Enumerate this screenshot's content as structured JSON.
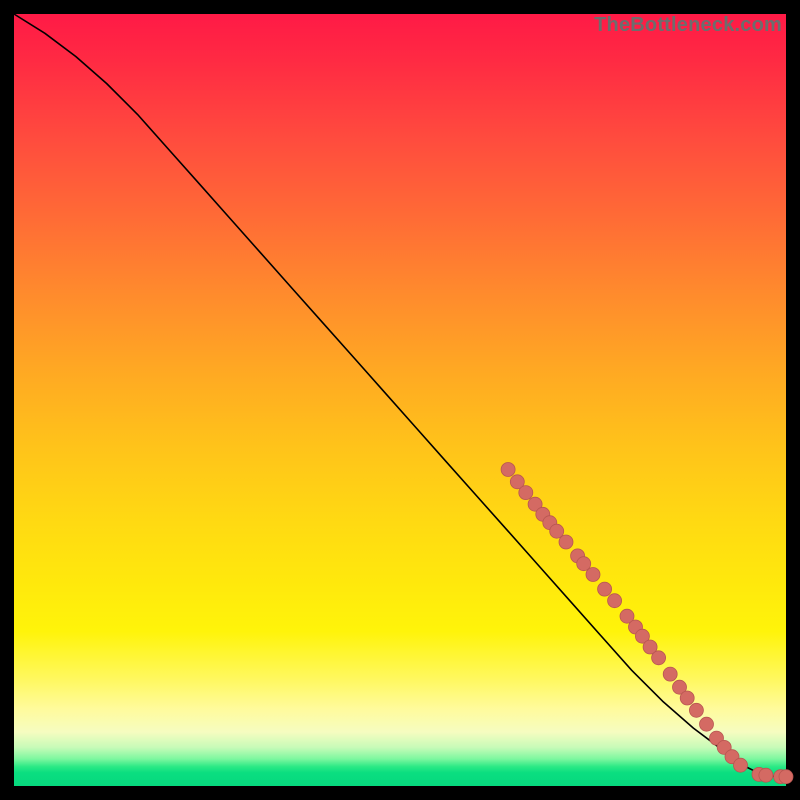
{
  "watermark": "TheBottleneck.com",
  "colors": {
    "dot_fill": "#d46a63",
    "dot_stroke": "#b85651",
    "line": "#000000"
  },
  "chart_data": {
    "type": "line",
    "title": "",
    "xlabel": "",
    "ylabel": "",
    "xlim": [
      0,
      100
    ],
    "ylim": [
      0,
      100
    ],
    "grid": false,
    "legend": false,
    "series": [
      {
        "name": "curve",
        "x": [
          0,
          4,
          8,
          12,
          16,
          20,
          24,
          28,
          32,
          36,
          40,
          44,
          48,
          52,
          56,
          60,
          64,
          68,
          72,
          76,
          80,
          84,
          88,
          90,
          92,
          94,
          95,
          96,
          97,
          98,
          99,
          100
        ],
        "y": [
          100,
          97.5,
          94.5,
          91,
          87,
          82.5,
          78,
          73.5,
          69,
          64.5,
          60,
          55.5,
          51,
          46.5,
          42,
          37.5,
          33,
          28.5,
          24,
          19.5,
          15,
          11,
          7.5,
          6,
          4.5,
          3,
          2.4,
          1.9,
          1.5,
          1.3,
          1.2,
          1.2
        ]
      }
    ],
    "points": [
      {
        "x": 64.0,
        "y": 41.0
      },
      {
        "x": 65.2,
        "y": 39.4
      },
      {
        "x": 66.3,
        "y": 38.0
      },
      {
        "x": 67.5,
        "y": 36.5
      },
      {
        "x": 68.5,
        "y": 35.2
      },
      {
        "x": 69.4,
        "y": 34.1
      },
      {
        "x": 70.3,
        "y": 33.0
      },
      {
        "x": 71.5,
        "y": 31.6
      },
      {
        "x": 73.0,
        "y": 29.8
      },
      {
        "x": 73.8,
        "y": 28.8
      },
      {
        "x": 75.0,
        "y": 27.4
      },
      {
        "x": 76.5,
        "y": 25.5
      },
      {
        "x": 77.8,
        "y": 24.0
      },
      {
        "x": 79.4,
        "y": 22.0
      },
      {
        "x": 80.5,
        "y": 20.6
      },
      {
        "x": 81.4,
        "y": 19.4
      },
      {
        "x": 82.4,
        "y": 18.0
      },
      {
        "x": 83.5,
        "y": 16.6
      },
      {
        "x": 85.0,
        "y": 14.5
      },
      {
        "x": 86.2,
        "y": 12.8
      },
      {
        "x": 87.2,
        "y": 11.4
      },
      {
        "x": 88.4,
        "y": 9.8
      },
      {
        "x": 89.7,
        "y": 8.0
      },
      {
        "x": 91.0,
        "y": 6.2
      },
      {
        "x": 92.0,
        "y": 5.0
      },
      {
        "x": 93.0,
        "y": 3.8
      },
      {
        "x": 94.1,
        "y": 2.7
      },
      {
        "x": 96.5,
        "y": 1.5
      },
      {
        "x": 97.4,
        "y": 1.4
      },
      {
        "x": 99.3,
        "y": 1.2
      },
      {
        "x": 100.0,
        "y": 1.2
      }
    ],
    "dot_radius_px": 7
  }
}
